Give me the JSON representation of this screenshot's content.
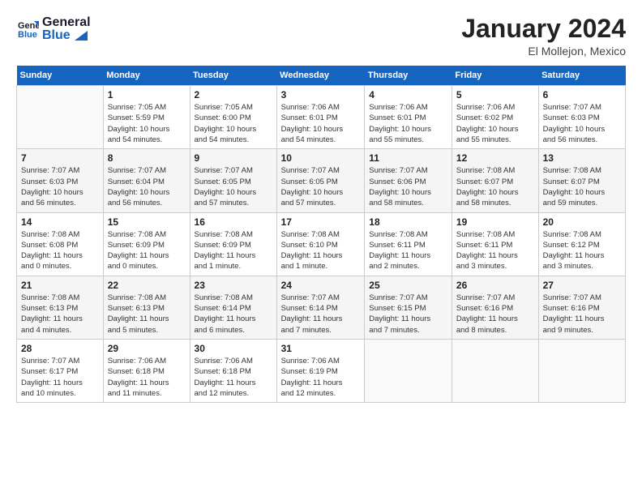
{
  "logo": {
    "line1": "General",
    "line2": "Blue"
  },
  "title": "January 2024",
  "location": "El Mollejon, Mexico",
  "days_header": [
    "Sunday",
    "Monday",
    "Tuesday",
    "Wednesday",
    "Thursday",
    "Friday",
    "Saturday"
  ],
  "weeks": [
    [
      {
        "num": "",
        "info": ""
      },
      {
        "num": "1",
        "info": "Sunrise: 7:05 AM\nSunset: 5:59 PM\nDaylight: 10 hours\nand 54 minutes."
      },
      {
        "num": "2",
        "info": "Sunrise: 7:05 AM\nSunset: 6:00 PM\nDaylight: 10 hours\nand 54 minutes."
      },
      {
        "num": "3",
        "info": "Sunrise: 7:06 AM\nSunset: 6:01 PM\nDaylight: 10 hours\nand 54 minutes."
      },
      {
        "num": "4",
        "info": "Sunrise: 7:06 AM\nSunset: 6:01 PM\nDaylight: 10 hours\nand 55 minutes."
      },
      {
        "num": "5",
        "info": "Sunrise: 7:06 AM\nSunset: 6:02 PM\nDaylight: 10 hours\nand 55 minutes."
      },
      {
        "num": "6",
        "info": "Sunrise: 7:07 AM\nSunset: 6:03 PM\nDaylight: 10 hours\nand 56 minutes."
      }
    ],
    [
      {
        "num": "7",
        "info": "Sunrise: 7:07 AM\nSunset: 6:03 PM\nDaylight: 10 hours\nand 56 minutes."
      },
      {
        "num": "8",
        "info": "Sunrise: 7:07 AM\nSunset: 6:04 PM\nDaylight: 10 hours\nand 56 minutes."
      },
      {
        "num": "9",
        "info": "Sunrise: 7:07 AM\nSunset: 6:05 PM\nDaylight: 10 hours\nand 57 minutes."
      },
      {
        "num": "10",
        "info": "Sunrise: 7:07 AM\nSunset: 6:05 PM\nDaylight: 10 hours\nand 57 minutes."
      },
      {
        "num": "11",
        "info": "Sunrise: 7:07 AM\nSunset: 6:06 PM\nDaylight: 10 hours\nand 58 minutes."
      },
      {
        "num": "12",
        "info": "Sunrise: 7:08 AM\nSunset: 6:07 PM\nDaylight: 10 hours\nand 58 minutes."
      },
      {
        "num": "13",
        "info": "Sunrise: 7:08 AM\nSunset: 6:07 PM\nDaylight: 10 hours\nand 59 minutes."
      }
    ],
    [
      {
        "num": "14",
        "info": "Sunrise: 7:08 AM\nSunset: 6:08 PM\nDaylight: 11 hours\nand 0 minutes."
      },
      {
        "num": "15",
        "info": "Sunrise: 7:08 AM\nSunset: 6:09 PM\nDaylight: 11 hours\nand 0 minutes."
      },
      {
        "num": "16",
        "info": "Sunrise: 7:08 AM\nSunset: 6:09 PM\nDaylight: 11 hours\nand 1 minute."
      },
      {
        "num": "17",
        "info": "Sunrise: 7:08 AM\nSunset: 6:10 PM\nDaylight: 11 hours\nand 1 minute."
      },
      {
        "num": "18",
        "info": "Sunrise: 7:08 AM\nSunset: 6:11 PM\nDaylight: 11 hours\nand 2 minutes."
      },
      {
        "num": "19",
        "info": "Sunrise: 7:08 AM\nSunset: 6:11 PM\nDaylight: 11 hours\nand 3 minutes."
      },
      {
        "num": "20",
        "info": "Sunrise: 7:08 AM\nSunset: 6:12 PM\nDaylight: 11 hours\nand 3 minutes."
      }
    ],
    [
      {
        "num": "21",
        "info": "Sunrise: 7:08 AM\nSunset: 6:13 PM\nDaylight: 11 hours\nand 4 minutes."
      },
      {
        "num": "22",
        "info": "Sunrise: 7:08 AM\nSunset: 6:13 PM\nDaylight: 11 hours\nand 5 minutes."
      },
      {
        "num": "23",
        "info": "Sunrise: 7:08 AM\nSunset: 6:14 PM\nDaylight: 11 hours\nand 6 minutes."
      },
      {
        "num": "24",
        "info": "Sunrise: 7:07 AM\nSunset: 6:14 PM\nDaylight: 11 hours\nand 7 minutes."
      },
      {
        "num": "25",
        "info": "Sunrise: 7:07 AM\nSunset: 6:15 PM\nDaylight: 11 hours\nand 7 minutes."
      },
      {
        "num": "26",
        "info": "Sunrise: 7:07 AM\nSunset: 6:16 PM\nDaylight: 11 hours\nand 8 minutes."
      },
      {
        "num": "27",
        "info": "Sunrise: 7:07 AM\nSunset: 6:16 PM\nDaylight: 11 hours\nand 9 minutes."
      }
    ],
    [
      {
        "num": "28",
        "info": "Sunrise: 7:07 AM\nSunset: 6:17 PM\nDaylight: 11 hours\nand 10 minutes."
      },
      {
        "num": "29",
        "info": "Sunrise: 7:06 AM\nSunset: 6:18 PM\nDaylight: 11 hours\nand 11 minutes."
      },
      {
        "num": "30",
        "info": "Sunrise: 7:06 AM\nSunset: 6:18 PM\nDaylight: 11 hours\nand 12 minutes."
      },
      {
        "num": "31",
        "info": "Sunrise: 7:06 AM\nSunset: 6:19 PM\nDaylight: 11 hours\nand 12 minutes."
      },
      {
        "num": "",
        "info": ""
      },
      {
        "num": "",
        "info": ""
      },
      {
        "num": "",
        "info": ""
      }
    ]
  ]
}
